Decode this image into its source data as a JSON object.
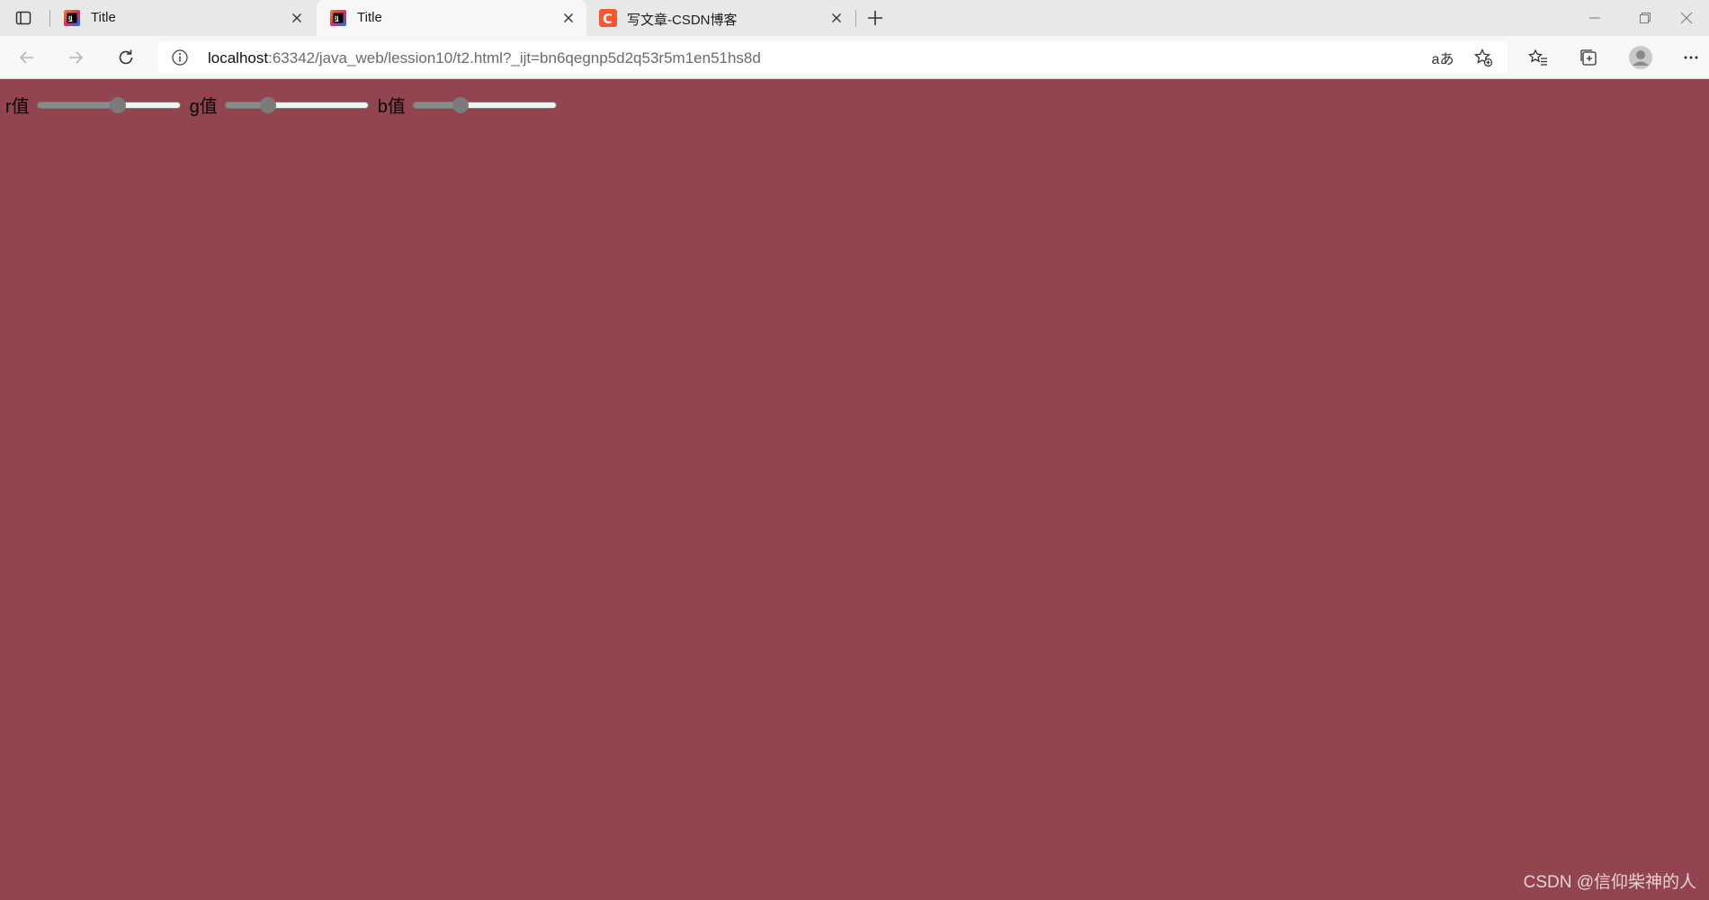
{
  "browser": {
    "tabs": [
      {
        "title": "Title",
        "favicon": "intellij-icon",
        "active": false
      },
      {
        "title": "Title",
        "favicon": "intellij-icon",
        "active": true
      },
      {
        "title": "写文章-CSDN博客",
        "favicon": "csdn-icon",
        "active": false
      }
    ],
    "address": {
      "host": "localhost",
      "rest": ":63342/java_web/lession10/t2.html?_ijt=bn6qegnp5d2q53r5m1en51hs8d"
    },
    "read_aloud_label": "aあ"
  },
  "page": {
    "background_color": "#93454f",
    "sliders": [
      {
        "label": "r值",
        "value": 147,
        "min": 0,
        "max": 255
      },
      {
        "label": "g值",
        "value": 69,
        "min": 0,
        "max": 255
      },
      {
        "label": "b值",
        "value": 79,
        "min": 0,
        "max": 255
      }
    ]
  },
  "watermark": "CSDN @信仰柴神的人"
}
